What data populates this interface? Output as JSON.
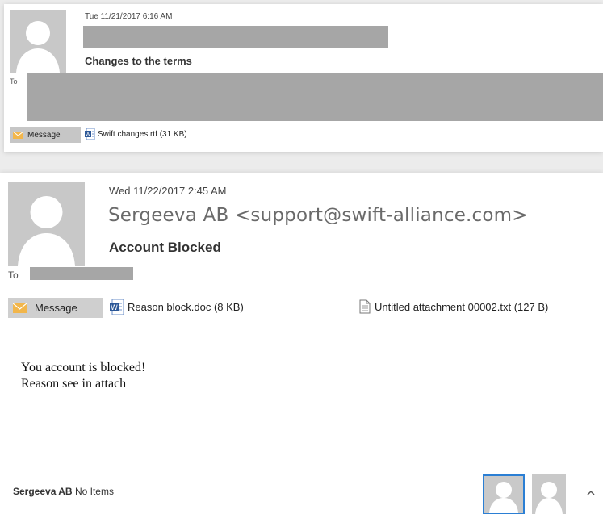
{
  "email1": {
    "date": "Tue 11/21/2017 6:16 AM",
    "subject": "Changes to the terms",
    "to_label": "To",
    "message_tab": "Message",
    "attachment": "Swift changes.rtf (31 KB)"
  },
  "email2": {
    "date": "Wed 11/22/2017 2:45 AM",
    "from": "Sergeeva AB <support@swift-alliance.com>",
    "subject": "Account Blocked",
    "to_label": "To",
    "message_tab": "Message",
    "attachments": [
      {
        "label": "Reason block.doc (8 KB)",
        "icon": "word-doc-icon"
      },
      {
        "label": "Untitled attachment 00002.txt (127 B)",
        "icon": "text-file-icon"
      }
    ],
    "body_lines": [
      "You account is blocked!",
      "Reason see in attach"
    ],
    "footer": {
      "name": "Sergeeva AB",
      "status": "No Items"
    }
  },
  "colors": {
    "redaction": "#a6a6a6",
    "envelope": "#f2b64b",
    "selected_border": "#2b7fd4"
  }
}
